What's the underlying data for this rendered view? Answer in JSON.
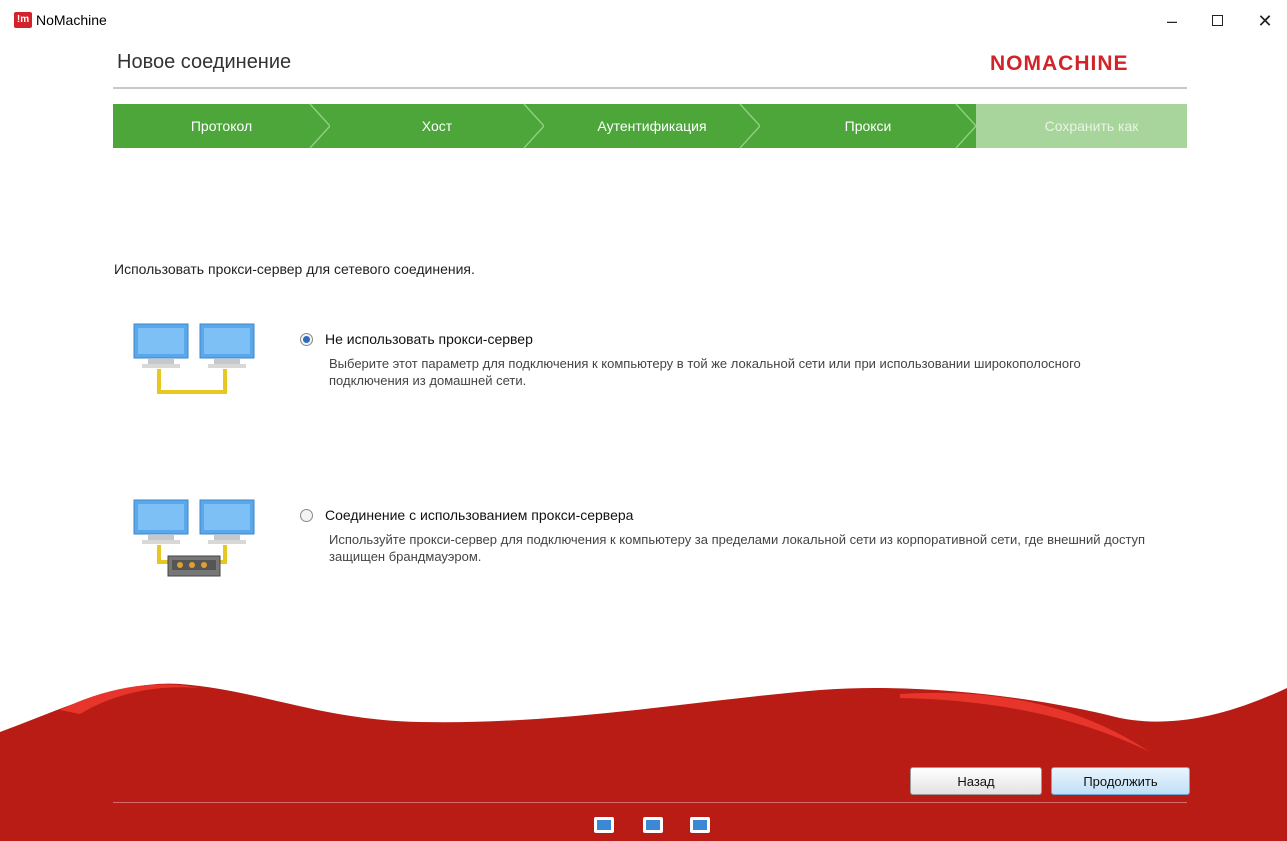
{
  "window": {
    "app_icon_text": "!m",
    "title": "NoMachine",
    "minimize_glyph": "–",
    "close_glyph": "✕"
  },
  "header": {
    "title": "Новое соединение",
    "brand": "NOMACHINE"
  },
  "steps": [
    {
      "label": "Протокол",
      "state": "done"
    },
    {
      "label": "Хост",
      "state": "done"
    },
    {
      "label": "Аутентификация",
      "state": "done"
    },
    {
      "label": "Прокси",
      "state": "current"
    },
    {
      "label": "Сохранить как",
      "state": "pending"
    }
  ],
  "intro": "Использовать прокси-сервер для сетевого соединения.",
  "options": [
    {
      "icon": "two-computers-icon",
      "title": "Не использовать прокси-сервер",
      "description": "Выберите этот параметр для подключения к компьютеру в той же локальной сети или при использовании широкополосного подключения из домашней сети.",
      "selected": true
    },
    {
      "icon": "proxy-computers-icon",
      "title": "Соединение с использованием прокси-сервера",
      "description": "Используйте прокси-сервер для подключения к компьютеру за пределами локальной сети из корпоративной сети, где внешний доступ защищен брандмауэром.",
      "selected": false
    }
  ],
  "buttons": {
    "back": "Назад",
    "next": "Продолжить"
  },
  "footer_icons": [
    "fullscreen-icon",
    "display-settings-icon",
    "window-icon"
  ],
  "colors": {
    "brand_red": "#d2232a",
    "footer_red": "#b81c14",
    "step_green": "#4ca63a",
    "step_pending": "#a8d59b"
  }
}
